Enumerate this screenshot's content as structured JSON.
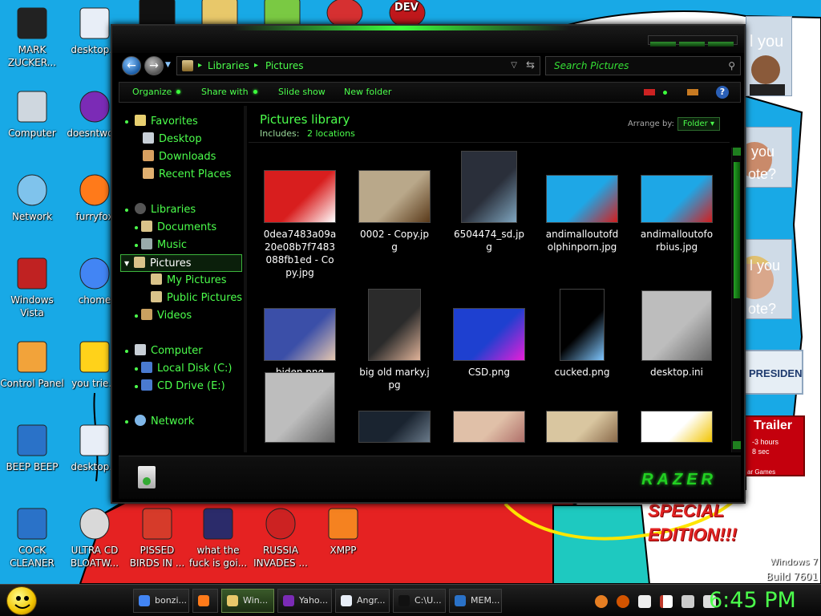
{
  "desktop_icons": [
    {
      "label": "MARK ZUCKER...",
      "icon": "mark-zuckerberg-icon"
    },
    {
      "label": "desktop...",
      "icon": "document-icon"
    },
    {
      "label": "Computer",
      "icon": "computer-icon"
    },
    {
      "label": "doesntwo...",
      "icon": "yahoo-messenger-icon"
    },
    {
      "label": "Network",
      "icon": "network-icon"
    },
    {
      "label": "furryfox",
      "icon": "firefox-icon"
    },
    {
      "label": "Windows Vista",
      "icon": "recycle-bin-icon"
    },
    {
      "label": "chome",
      "icon": "chrome-icon"
    },
    {
      "label": "Control Panel",
      "icon": "control-panel-icon"
    },
    {
      "label": "you trie...",
      "icon": "star-icon"
    },
    {
      "label": "BEEP BEEP",
      "icon": "blue-book-icon"
    },
    {
      "label": "desktop...",
      "icon": "document-icon"
    },
    {
      "label": "COCK CLEANER",
      "icon": "blue-book-icon"
    },
    {
      "label": "ULTRA CD BLOATW...",
      "icon": "cd-icon"
    },
    {
      "label": "PISSED BIRDS IN ...",
      "icon": "angry-bird-icon"
    },
    {
      "label": "what the fuck is goi...",
      "icon": "angry-bird-space-icon"
    },
    {
      "label": "RUSSIA INVADES ...",
      "icon": "radiation-icon"
    },
    {
      "label": "XMPP",
      "icon": "xampp-icon"
    }
  ],
  "top_icons": [
    {
      "label": "",
      "icon": "cmd-icon"
    },
    {
      "label": "",
      "icon": "folder-icon"
    },
    {
      "label": "",
      "icon": "android-icon"
    },
    {
      "label": "",
      "icon": "red-p-icon"
    },
    {
      "label": "DEV",
      "icon": "dev-icon"
    }
  ],
  "background_text": {
    "panel1": "l you",
    "panel2": "you",
    "panel2b": "ote?",
    "panel3": "l you",
    "panel3b": "ote?",
    "president": "PRESIDENT",
    "trailer": "Trailer",
    "trailer_sub": "-3 hours",
    "trailer_sub2": "8 sec",
    "trailer_sub3": "ar Games",
    "special": "SPECIAL EDITION!!!",
    "watermark1": "Windows 7",
    "watermark2": "Build 7601"
  },
  "window": {
    "breadcrumb": [
      "Libraries",
      "Pictures"
    ],
    "search_placeholder": "Search Pictures",
    "commands": [
      "Organize",
      "Share with",
      "Slide show",
      "New folder"
    ],
    "library_title": "Pictures library",
    "includes_label": "Includes:",
    "includes_link": "2 locations",
    "arrange_label": "Arrange by:",
    "arrange_value": "Folder",
    "brand": "RAZER"
  },
  "nav_tree": {
    "favorites": "Favorites",
    "desktop": "Desktop",
    "downloads": "Downloads",
    "recent": "Recent Places",
    "libraries": "Libraries",
    "documents": "Documents",
    "music": "Music",
    "pictures": "Pictures",
    "my_pictures": "My Pictures",
    "public_pictures": "Public Pictures",
    "videos": "Videos",
    "computer": "Computer",
    "local_disk": "Local Disk (C:)",
    "cd_drive": "CD Drive (E:)",
    "network": "Network"
  },
  "files": [
    {
      "name": "0dea7483a09a20e08b7f7483088fb1ed - Copy.jpg",
      "thumb": "cartoon-red-flag"
    },
    {
      "name": "0002 - Copy.jpg",
      "thumb": "toilet"
    },
    {
      "name": "6504474_sd.jpg",
      "thumb": "movie-poster"
    },
    {
      "name": "andimalloutofdolphinporn.jpg",
      "thumb": "cartoon-man"
    },
    {
      "name": "andimalloutoforbius.jpg",
      "thumb": "cartoon-man"
    },
    {
      "name": "biden.png",
      "thumb": "photo-face"
    },
    {
      "name": "big old marky.jpg",
      "thumb": "portrait"
    },
    {
      "name": "CSD.png",
      "thumb": "blue-badge"
    },
    {
      "name": "cucked.png",
      "thumb": "blue-figure"
    },
    {
      "name": "desktop.ini",
      "thumb": "settings-file"
    },
    {
      "name": "",
      "thumb": "settings-file"
    },
    {
      "name": "",
      "thumb": "dark-face"
    },
    {
      "name": "",
      "thumb": "photo-skin"
    },
    {
      "name": "",
      "thumb": "pyramid"
    },
    {
      "name": "",
      "thumb": "yellow-map"
    }
  ],
  "taskbar": {
    "items": [
      {
        "label": "bonzi...",
        "icon": "chrome-icon"
      },
      {
        "label": "",
        "icon": "firefox-icon"
      },
      {
        "label": "Win...",
        "icon": "folder-icon"
      },
      {
        "label": "Yaho...",
        "icon": "yahoo-messenger-icon"
      },
      {
        "label": "Angr...",
        "icon": "document-icon"
      },
      {
        "label": "C:\\U...",
        "icon": "cmd-icon"
      },
      {
        "label": "MEM...",
        "icon": "blue-book-icon"
      }
    ],
    "clock": "6:45 PM"
  },
  "colors": {
    "accent": "#4cff4c",
    "desktop_bg": "#18a9e6",
    "window_bg": "#000000"
  }
}
